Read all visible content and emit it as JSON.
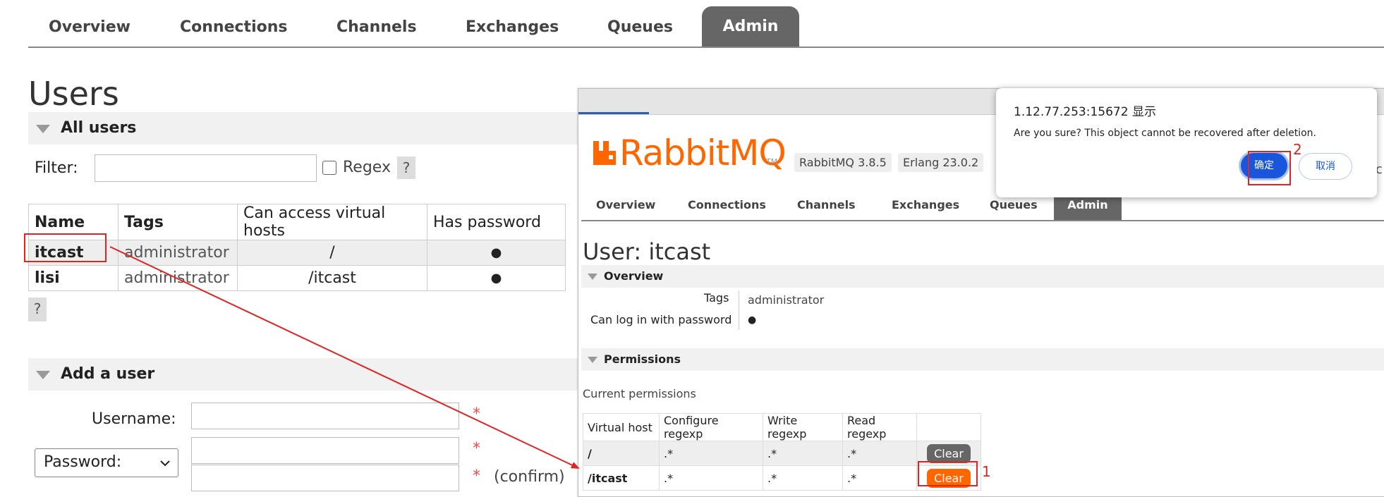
{
  "nav": {
    "tabs": [
      "Overview",
      "Connections",
      "Channels",
      "Exchanges",
      "Queues",
      "Admin"
    ],
    "active": "Admin"
  },
  "page": {
    "title": "Users"
  },
  "all_users": {
    "section_title": "All users",
    "filter_label": "Filter:",
    "filter_value": "",
    "regex_label": "Regex",
    "help_label": "?",
    "columns": [
      "Name",
      "Tags",
      "Can access virtual hosts",
      "Has password"
    ],
    "rows": [
      {
        "name": "itcast",
        "tags": "administrator",
        "vhosts": "/",
        "has_password": "●"
      },
      {
        "name": "lisi",
        "tags": "administrator",
        "vhosts": "/itcast",
        "has_password": "●"
      }
    ],
    "table_help": "?"
  },
  "add_user": {
    "section_title": "Add a user",
    "username_label": "Username:",
    "password_select": "Password:",
    "required_mark": "*",
    "confirm_label": "(confirm)"
  },
  "overlay": {
    "logo_text": "RabbitMQ",
    "logo_tm": "TM",
    "version_rabbit": "RabbitMQ 3.8.5",
    "version_erlang": "Erlang 23.0.2",
    "nav_tabs": [
      "Overview",
      "Connections",
      "Channels",
      "Exchanges",
      "Queues",
      "Admin"
    ],
    "user_title_prefix": "User:",
    "user_name": "itcast",
    "overview_title": "Overview",
    "tags_label": "Tags",
    "tags_value": "administrator",
    "can_login_label": "Can log in with password",
    "can_login_value": "●",
    "permissions_title": "Permissions",
    "current_permissions": "Current permissions",
    "perm_columns": [
      "Virtual host",
      "Configure regexp",
      "Write regexp",
      "Read regexp"
    ],
    "perm_rows": [
      {
        "vhost": "/",
        "configure": ".*",
        "write": ".*",
        "read": ".*",
        "action": "Clear"
      },
      {
        "vhost": "/itcast",
        "configure": ".*",
        "write": ".*",
        "read": ".*",
        "action": "Clear"
      }
    ],
    "edge_char": "c"
  },
  "dialog": {
    "origin": "1.12.77.253:15672 显示",
    "message": "Are you sure? This object cannot be recovered after deletion.",
    "ok_label": "确定",
    "cancel_label": "取消"
  },
  "annotations": {
    "step1": "1",
    "step2": "2"
  },
  "colors": {
    "accent": "#ff6600",
    "nav_active": "#666666",
    "annotation": "#e02424",
    "dialog_ok": "#1a56db"
  }
}
